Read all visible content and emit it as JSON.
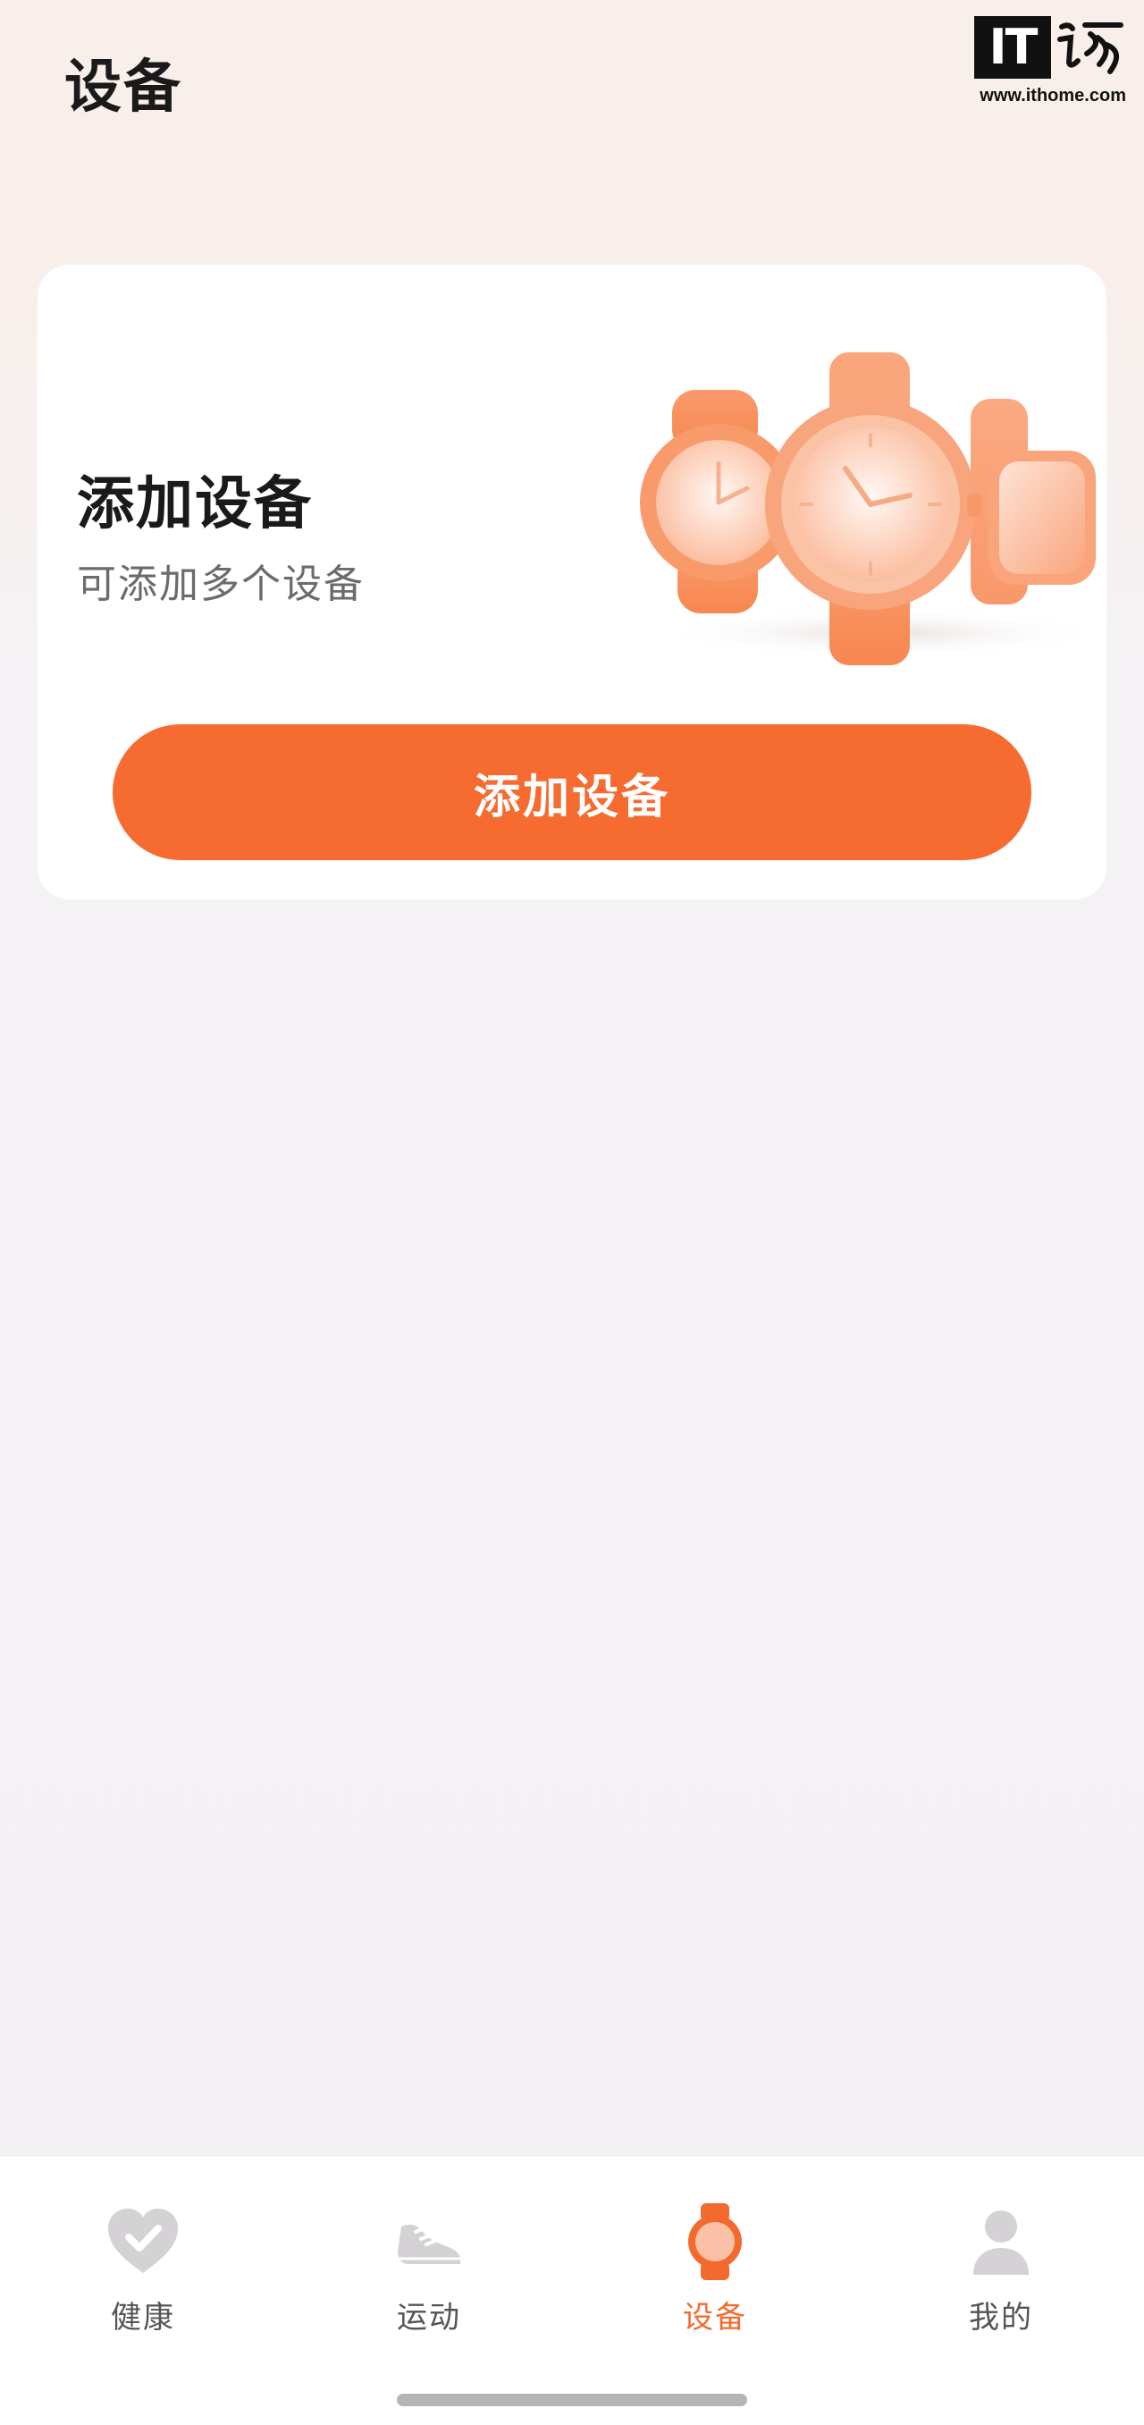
{
  "header": {
    "title": "设备"
  },
  "watermark": {
    "logo_text": "IT",
    "url": "www.ithome.com"
  },
  "card": {
    "title": "添加设备",
    "subtitle": "可添加多个设备",
    "illustration_icon": "smartwatches-illustration",
    "button_label": "添加设备"
  },
  "bottom_nav": {
    "active_tab": "设备",
    "items": [
      {
        "label": "健康",
        "icon": "heart-check-icon"
      },
      {
        "label": "运动",
        "icon": "running-shoe-icon"
      },
      {
        "label": "设备",
        "icon": "watch-icon"
      },
      {
        "label": "我的",
        "icon": "person-icon"
      }
    ]
  },
  "colors": {
    "accent": "#f66b30",
    "active_tab": "#f36a2f",
    "inactive_icon": "#d4d2d4",
    "card_background": "#ffffff",
    "page_background": "#f3f1f3"
  }
}
